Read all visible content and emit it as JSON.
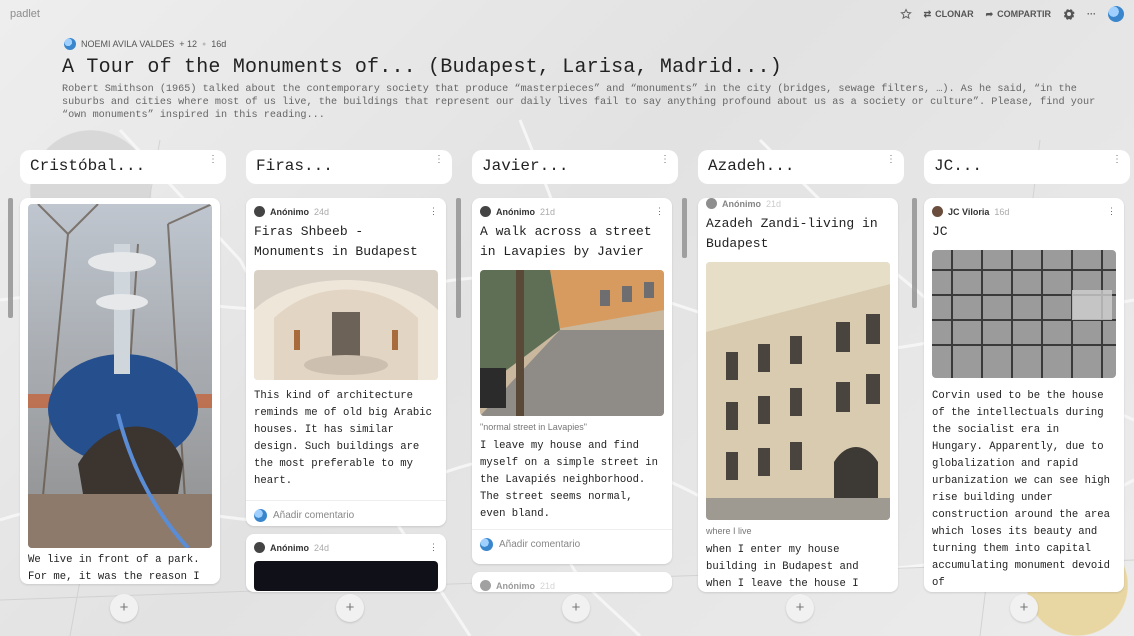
{
  "app": {
    "brand": "padlet"
  },
  "toolbar": {
    "clone_label": "CLONAR",
    "share_label": "COMPARTIR",
    "more_label": "···"
  },
  "header": {
    "author": "NOEMI AVILA VALDES",
    "plus": "+ 12",
    "dot": "●",
    "age": "16d",
    "title": "A Tour of the Monuments of... (Budapest, Larisa, Madrid...)",
    "description": "Robert Smithson (1965) talked about the contemporary society that produce “masterpieces” and “monuments” in the city (bridges, sewage filters, …). As he said, “in the suburbs and cities where most of us live, the buildings that represent our daily lives fail to say anything profound about us as a society or culture”. Please, find your “own monuments” inspired in this reading..."
  },
  "columns": [
    {
      "name": "Cristóbal...",
      "cards": [
        {
          "body": "We live in front of a park. For me, it was the reason I"
        }
      ]
    },
    {
      "name": "Firas...",
      "cards": [
        {
          "author": "Anónimo",
          "age": "24d",
          "title": "Firas Shbeeb - Monuments in Budapest",
          "body": "This kind of architecture reminds me of old big Arabic houses. It has similar design. Such buildings are the most preferable to my heart.",
          "comment": "Añadir comentario"
        },
        {
          "author": "Anónimo",
          "age": "24d"
        }
      ]
    },
    {
      "name": "Javier...",
      "cards": [
        {
          "author": "Anónimo",
          "age": "21d",
          "title": "A walk across a street in Lavapies by Javier",
          "caption": "\"normal street in Lavapies\"",
          "body": "I leave my house and find myself on a simple street in the Lavapiés neighborhood. The street seems normal, even bland.",
          "comment": "Añadir comentario"
        },
        {
          "author": "Anónimo",
          "age": "21d"
        }
      ]
    },
    {
      "name": "Azadeh...",
      "cards": [
        {
          "author": "Anónimo",
          "age": "21d",
          "title": "Azadeh Zandi-living in Budapest",
          "caption": "where I live",
          "body": "when I enter my house building in Budapest and when I leave the house I"
        }
      ]
    },
    {
      "name": "JC...",
      "cards": [
        {
          "author": "JC Viloria",
          "age": "16d",
          "title": "JC",
          "body": "Corvin used to be the house of the intellectuals during the socialist era in Hungary. Apparently, due to globalization and rapid urbanization we can see high rise building under construction around the area which loses its beauty and turning them into capital accumulating monument devoid of"
        }
      ]
    }
  ],
  "add_label": "+",
  "more_icon": "⋮"
}
